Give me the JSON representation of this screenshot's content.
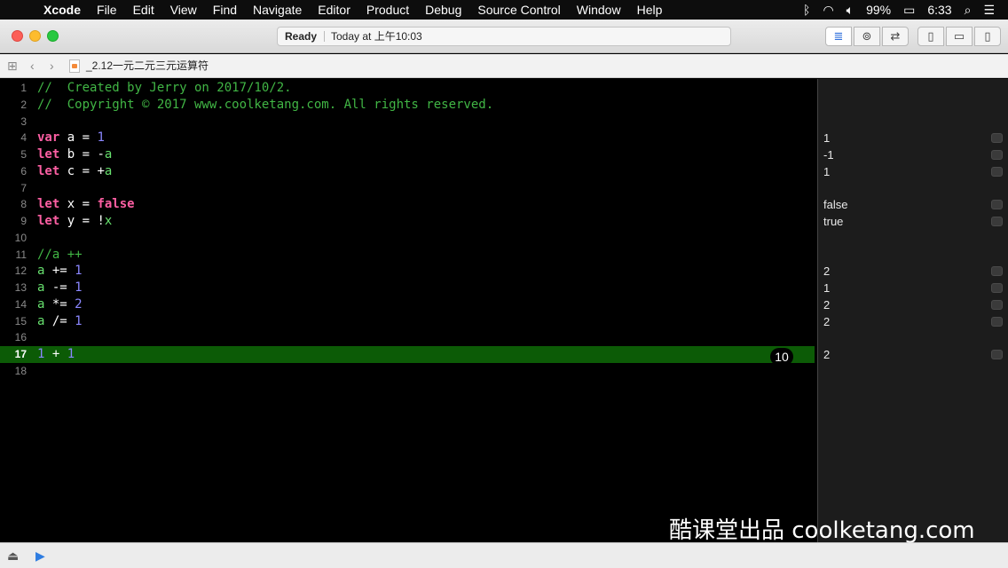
{
  "menubar": {
    "app_name": "Xcode",
    "items": [
      "File",
      "Edit",
      "View",
      "Find",
      "Navigate",
      "Editor",
      "Product",
      "Debug",
      "Source Control",
      "Window",
      "Help"
    ],
    "battery": "99%",
    "clock": "6:33"
  },
  "toolbar": {
    "status": "Ready",
    "timestamp": "Today at 上午10:03"
  },
  "jumpbar": {
    "filename": "_2.12一元二元三元运算符"
  },
  "editor": {
    "lines": [
      {
        "n": "1",
        "tokens": [
          {
            "t": "//  Created by Jerry on 2017/10/2.",
            "k": "comment"
          }
        ]
      },
      {
        "n": "2",
        "tokens": [
          {
            "t": "//  Copyright © 2017 www.coolketang.com. All rights reserved.",
            "k": "comment"
          }
        ]
      },
      {
        "n": "3",
        "tokens": []
      },
      {
        "n": "4",
        "tokens": [
          {
            "t": "var",
            "k": "kw"
          },
          {
            "t": " a = ",
            "k": "plain"
          },
          {
            "t": "1",
            "k": "num"
          }
        ]
      },
      {
        "n": "5",
        "tokens": [
          {
            "t": "let",
            "k": "kw"
          },
          {
            "t": " b = -",
            "k": "plain"
          },
          {
            "t": "a",
            "k": "var"
          }
        ]
      },
      {
        "n": "6",
        "tokens": [
          {
            "t": "let",
            "k": "kw"
          },
          {
            "t": " c = +",
            "k": "plain"
          },
          {
            "t": "a",
            "k": "var"
          }
        ]
      },
      {
        "n": "7",
        "tokens": []
      },
      {
        "n": "8",
        "tokens": [
          {
            "t": "let",
            "k": "kw"
          },
          {
            "t": " x = ",
            "k": "plain"
          },
          {
            "t": "false",
            "k": "kw"
          }
        ]
      },
      {
        "n": "9",
        "tokens": [
          {
            "t": "let",
            "k": "kw"
          },
          {
            "t": " y = !",
            "k": "plain"
          },
          {
            "t": "x",
            "k": "var"
          }
        ]
      },
      {
        "n": "10",
        "tokens": []
      },
      {
        "n": "11",
        "tokens": [
          {
            "t": "//a ++",
            "k": "comment"
          }
        ]
      },
      {
        "n": "12",
        "tokens": [
          {
            "t": "a",
            "k": "var"
          },
          {
            "t": " += ",
            "k": "plain"
          },
          {
            "t": "1",
            "k": "num"
          }
        ]
      },
      {
        "n": "13",
        "tokens": [
          {
            "t": "a",
            "k": "var"
          },
          {
            "t": " -= ",
            "k": "plain"
          },
          {
            "t": "1",
            "k": "num"
          }
        ]
      },
      {
        "n": "14",
        "tokens": [
          {
            "t": "a",
            "k": "var"
          },
          {
            "t": " *= ",
            "k": "plain"
          },
          {
            "t": "2",
            "k": "num"
          }
        ]
      },
      {
        "n": "15",
        "tokens": [
          {
            "t": "a",
            "k": "var"
          },
          {
            "t": " /= ",
            "k": "plain"
          },
          {
            "t": "1",
            "k": "num"
          }
        ]
      },
      {
        "n": "16",
        "tokens": []
      },
      {
        "n": "17",
        "current": true,
        "tokens": [
          {
            "t": "1",
            "k": "num"
          },
          {
            "t": " + ",
            "k": "plain"
          },
          {
            "t": "1",
            "k": "num"
          }
        ]
      },
      {
        "n": "18",
        "tokens": []
      }
    ],
    "inline_result": "10"
  },
  "results": [
    {
      "line": 4,
      "value": "1"
    },
    {
      "line": 5,
      "value": "-1"
    },
    {
      "line": 6,
      "value": "1"
    },
    {
      "line": 8,
      "value": "false"
    },
    {
      "line": 9,
      "value": "true"
    },
    {
      "line": 12,
      "value": "2"
    },
    {
      "line": 13,
      "value": "1"
    },
    {
      "line": 14,
      "value": "2"
    },
    {
      "line": 15,
      "value": "2"
    },
    {
      "line": 17,
      "value": "2"
    }
  ],
  "watermark": "酷课堂出品 coolketang.com",
  "colors": {
    "comment": "#41b645",
    "keyword": "#fc5fa3",
    "number": "#8b87ff",
    "variable": "#67e06e",
    "current_line": "#0c5b06"
  }
}
